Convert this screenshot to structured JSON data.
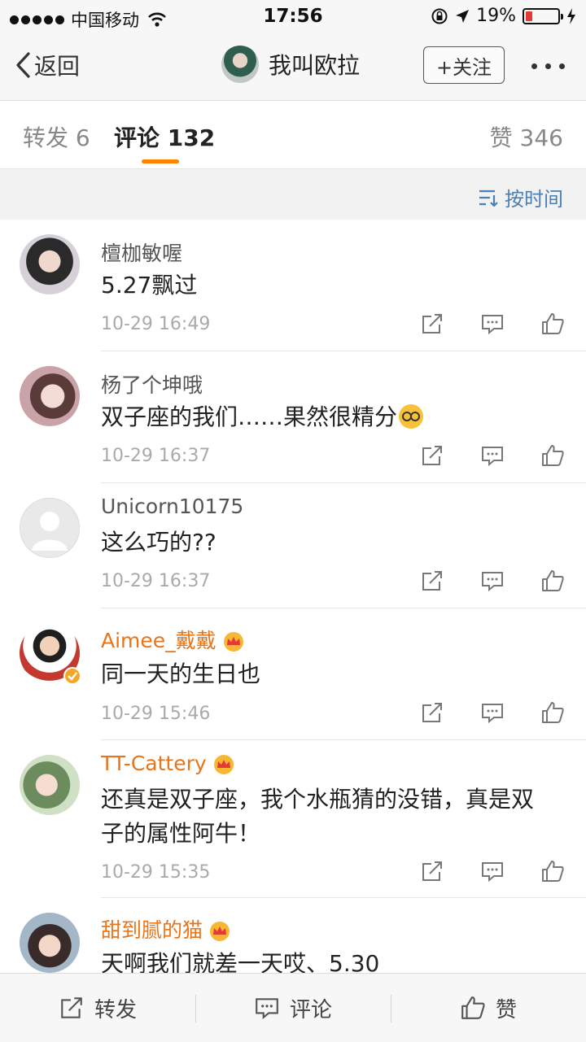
{
  "status_bar": {
    "carrier": "中国移动",
    "time": "17:56",
    "battery": "19%",
    "battery_level": 0.19
  },
  "nav": {
    "back_label": "返回",
    "title": "我叫欧拉",
    "follow_label": "+关注"
  },
  "tabs": {
    "repost_label": "转发",
    "repost_count": "6",
    "comment_label": "评论",
    "comment_count": "132",
    "like_label": "赞",
    "like_count": "346"
  },
  "sort": {
    "label": "按时间"
  },
  "comments": [
    {
      "name": "檀枷敏喔",
      "text": "5.27飘过",
      "time": "10-29 16:49",
      "vip": false
    },
    {
      "name": "杨了个坤哦",
      "text": "双子座的我们……果然很精分",
      "emoji": "nerd-face",
      "time": "10-29 16:37",
      "vip": false
    },
    {
      "name": "Unicorn10175",
      "text": "这么巧的??",
      "time": "10-29 16:37",
      "vip": false
    },
    {
      "name": "Aimee_戴戴",
      "text": "同一天的生日也",
      "time": "10-29 15:46",
      "vip": true,
      "verified": true
    },
    {
      "name": "TT-Cattery",
      "text": "还真是双子座，我个水瓶猜的没错，真是双子的属性阿牛！",
      "time": "10-29 15:35",
      "vip": true
    },
    {
      "name": "甜到腻的猫",
      "text": "天啊我们就差一天哎、5.30",
      "vip": true
    }
  ],
  "bottom_bar": {
    "repost_label": "转发",
    "comment_label": "评论",
    "like_label": "赞"
  },
  "colors": {
    "accent": "#ff8200",
    "vip_name": "#e8751a",
    "link": "#4a80b5"
  }
}
